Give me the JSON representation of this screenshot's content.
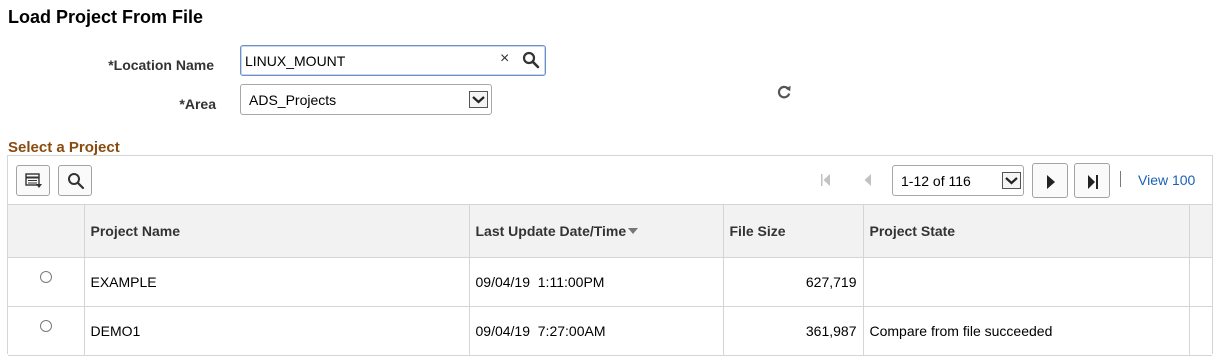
{
  "page": {
    "title": "Load Project From File"
  },
  "form": {
    "location_label": "*Location Name",
    "location_value": "LINUX_MOUNT",
    "clear_symbol": "×",
    "area_label": "*Area",
    "area_value": "ADS_Projects"
  },
  "grid": {
    "title": "Select a Project",
    "pagination": {
      "range": "1-12 of 116",
      "view_all": "View 100"
    },
    "columns": [
      "",
      "Project Name",
      "Last Update Date/Time",
      "File Size",
      "Project State",
      ""
    ],
    "sort": {
      "column": "Last Update Date/Time",
      "direction": "descending"
    },
    "rows": [
      {
        "name": "EXAMPLE",
        "updated": "09/04/19  1:11:00PM",
        "size": "627,719",
        "state": ""
      },
      {
        "name": "DEMO1",
        "updated": "09/04/19  7:27:00AM",
        "size": "361,987",
        "state": "Compare from file succeeded"
      }
    ]
  },
  "icons": {
    "search": "search-icon",
    "clear": "close-icon",
    "refresh": "refresh-icon",
    "personalize": "personalize-grid-icon",
    "find": "search-icon",
    "first": "first-page-icon",
    "prev": "previous-page-icon",
    "next": "next-page-icon",
    "last": "last-page-icon",
    "dropdown": "chevron-down-icon",
    "sort": "sort-descending-icon"
  },
  "colors": {
    "section_title": "#8a4b0f",
    "link": "#1a62b3",
    "header_bg": "#f2f2f2",
    "border": "#d5d5d5",
    "focus_border": "#6d8fc4"
  }
}
